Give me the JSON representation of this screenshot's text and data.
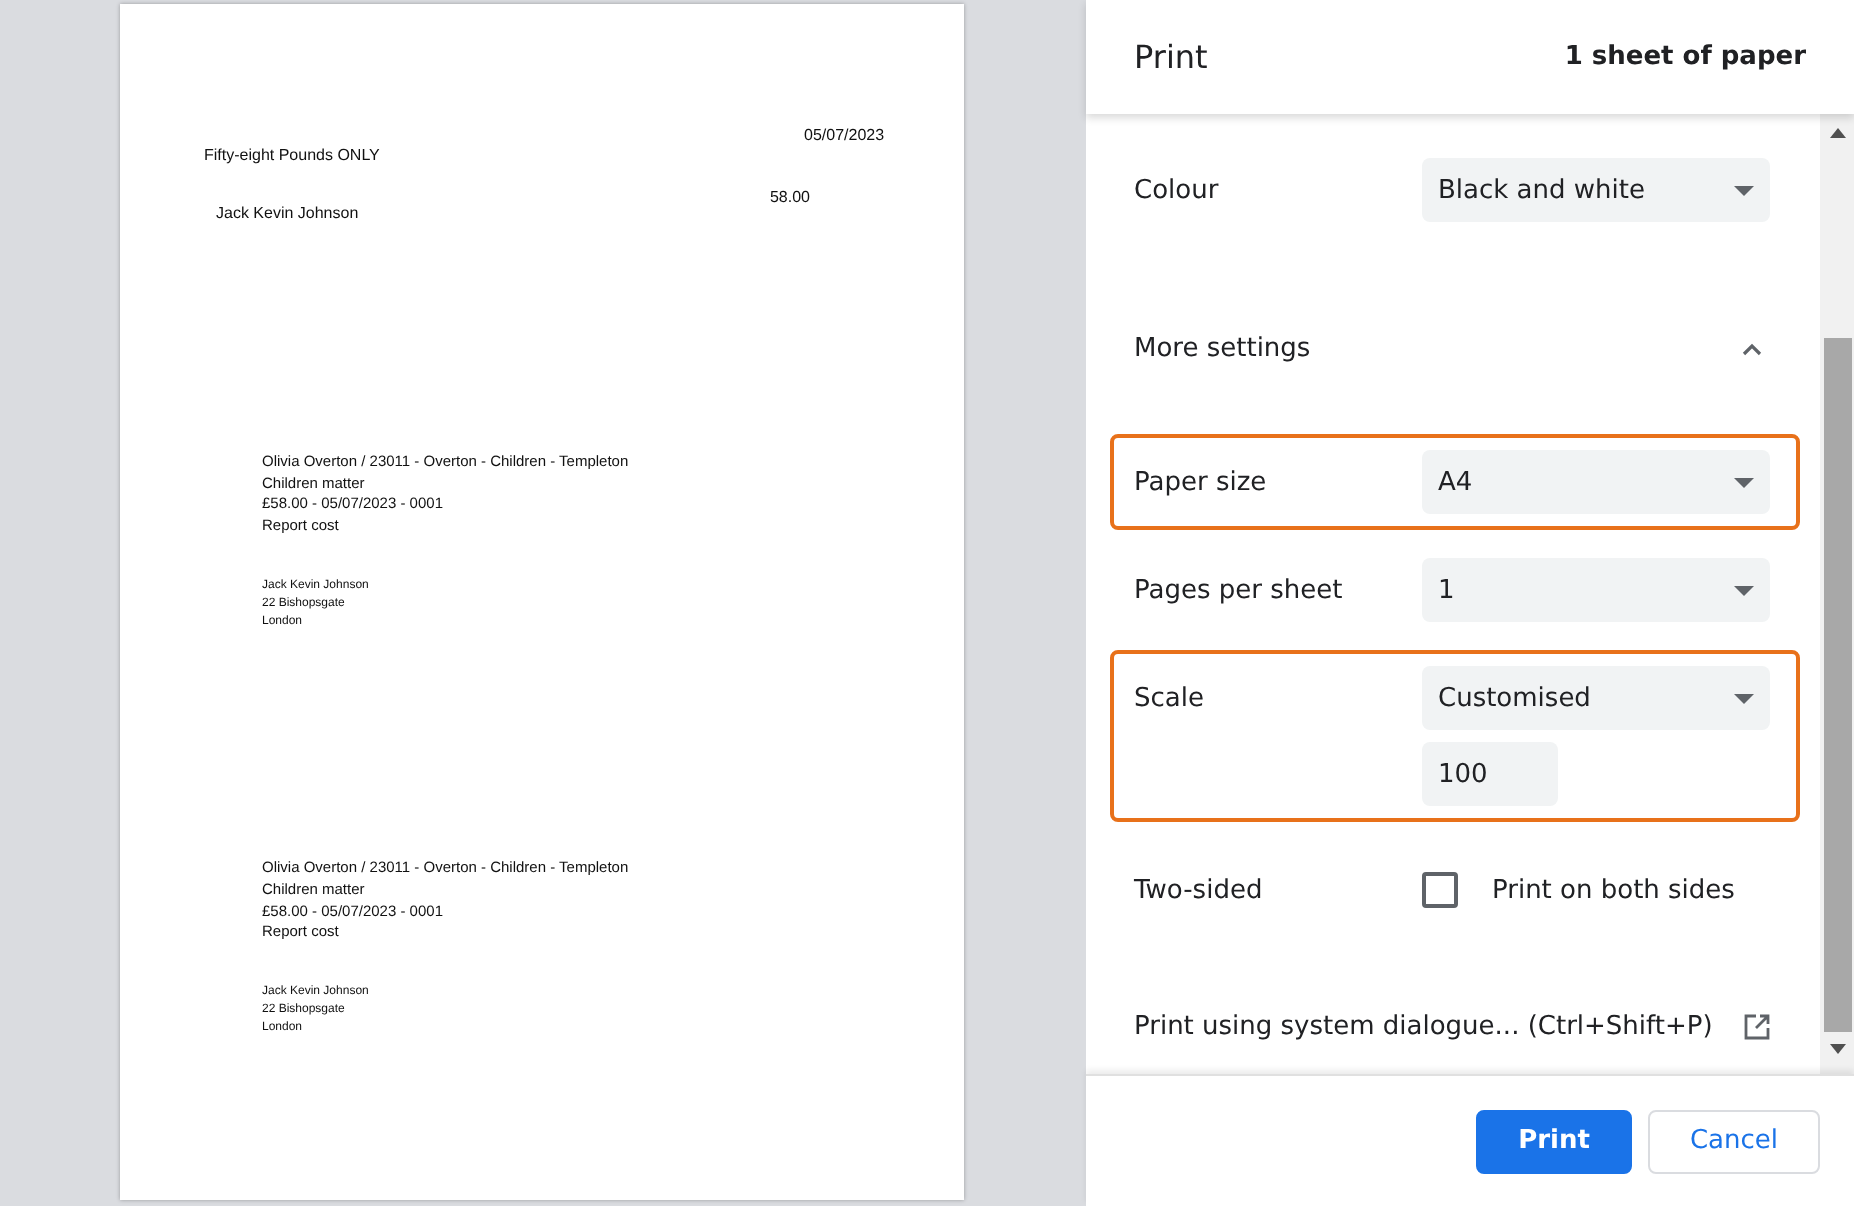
{
  "preview": {
    "date": "05/07/2023",
    "amount_words": "Fifty-eight Pounds ONLY",
    "payee": "Jack Kevin Johnson",
    "amount": "58.00",
    "stubs": [
      {
        "lines": [
          "Olivia Overton / 23011 - Overton - Children - Templeton",
          "Children matter",
          "£58.00 - 05/07/2023 - 0001",
          "Report cost"
        ],
        "address": [
          "Jack Kevin Johnson",
          "22 Bishopsgate",
          "London"
        ]
      },
      {
        "lines": [
          "Olivia Overton / 23011 - Overton - Children - Templeton",
          "Children matter",
          "£58.00 - 05/07/2023 - 0001",
          "Report cost"
        ],
        "address": [
          "Jack Kevin Johnson",
          "22 Bishopsgate",
          "London"
        ]
      }
    ]
  },
  "header": {
    "title": "Print",
    "sheets": "1 sheet of paper"
  },
  "settings": [
    {
      "kind": "select",
      "label": "Colour",
      "value": "Black and white",
      "highlighted": false
    },
    {
      "kind": "toggle",
      "label": "More settings",
      "expanded": true
    },
    {
      "kind": "select",
      "label": "Paper size",
      "value": "A4",
      "highlighted": true
    },
    {
      "kind": "select",
      "label": "Pages per sheet",
      "value": "1",
      "highlighted": false
    },
    {
      "kind": "scale",
      "label": "Scale",
      "value": "Customised",
      "custom_value": "100",
      "highlighted": true
    },
    {
      "kind": "checkbox",
      "label": "Two-sided",
      "option": "Print on both sides",
      "checked": false
    },
    {
      "kind": "link",
      "label": "Print using system dialogue... (Ctrl+Shift+P)"
    }
  ],
  "buttons": [
    {
      "label": "Print",
      "primary": true
    },
    {
      "label": "Cancel",
      "primary": false
    }
  ]
}
